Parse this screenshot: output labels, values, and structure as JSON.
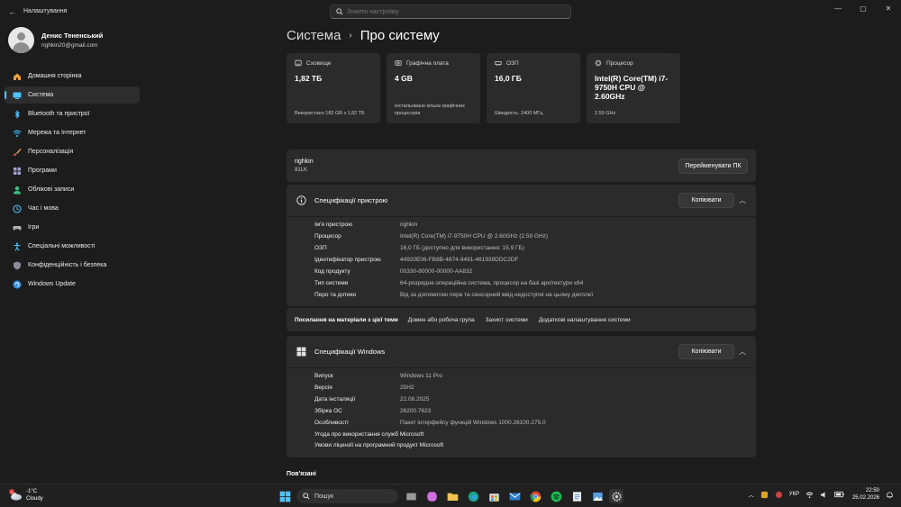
{
  "app": {
    "title": "Налаштування"
  },
  "search": {
    "placeholder": "Знайти настройку"
  },
  "profile": {
    "name": "Денис Тененський",
    "email": "righkin20@gmail.com"
  },
  "sidebar": {
    "items": [
      {
        "label": "Домашня сторінка",
        "icon": "home-icon"
      },
      {
        "label": "Система",
        "icon": "system-icon",
        "active": true
      },
      {
        "label": "Bluetooth та пристрої",
        "icon": "bluetooth-icon"
      },
      {
        "label": "Мережа та Інтернет",
        "icon": "network-icon"
      },
      {
        "label": "Персоналізація",
        "icon": "brush-icon"
      },
      {
        "label": "Програми",
        "icon": "apps-icon"
      },
      {
        "label": "Облікові записи",
        "icon": "account-icon"
      },
      {
        "label": "Час і мова",
        "icon": "clock-globe-icon"
      },
      {
        "label": "Ігри",
        "icon": "gamepad-icon"
      },
      {
        "label": "Спеціальні можливості",
        "icon": "accessibility-icon"
      },
      {
        "label": "Конфіденційність і безпека",
        "icon": "shield-icon"
      },
      {
        "label": "Windows Update",
        "icon": "update-icon"
      }
    ]
  },
  "breadcrumb": {
    "parent": "Система",
    "separator": "›",
    "current": "Про систему"
  },
  "cards": [
    {
      "title": "Сховище",
      "value": "1,82 ТБ",
      "sub": "Використано 182 GB з 1,82 ТБ",
      "icon": "storage-icon"
    },
    {
      "title": "Графічна плата",
      "value": "4 GB",
      "sub": "Інстальовано кілька графічних процесорів",
      "icon": "gpu-icon"
    },
    {
      "title": "ОЗП",
      "value": "16,0 ГБ",
      "sub": "Швидкість: 2400 МГц",
      "icon": "ram-icon"
    },
    {
      "title": "Процесор",
      "value": "Intel(R) Core(TM) i7-9750H CPU @ 2.60GHz",
      "sub": "2.59 GHz",
      "icon": "cpu-icon"
    }
  ],
  "pc": {
    "name": "righkin",
    "model": "81LK",
    "rename_label": "Перейменувати ПК"
  },
  "device_specs": {
    "title": "Специфікації пристрою",
    "copy_label": "Копіювати",
    "rows": [
      {
        "label": "Ім'я пристрою",
        "value": "righkin"
      },
      {
        "label": "Процесор",
        "value": "Intel(R) Core(TM) i7-9750H CPU @ 2.60GHz (2.59 GHz)"
      },
      {
        "label": "ОЗП",
        "value": "16,0 ГБ (доступно для використання: 15,9 ГБ)"
      },
      {
        "label": "Ідентифікатор пристрою",
        "value": "44920E06-FB8B-4874-9491-461939DDC2DF"
      },
      {
        "label": "Код продукту",
        "value": "00330-80000-00000-AA832"
      },
      {
        "label": "Тип системи",
        "value": "64-розрядна операційна система, процесор на базі архітектури x64"
      },
      {
        "label": "Перо та дотики",
        "value": "Від за допомогою пера та сенсорний ввід недоступні на цьому дисплеї"
      }
    ]
  },
  "related_links": {
    "label": "Посилання на матеріали з цієї теми",
    "links": [
      "Домен або робоча група",
      "Захист системи",
      "Додаткові налаштування системи"
    ]
  },
  "windows_specs": {
    "title": "Специфікації Windows",
    "copy_label": "Копіювати",
    "rows": [
      {
        "label": "Випуск",
        "value": "Windows 11 Pro"
      },
      {
        "label": "Версія",
        "value": "25H2"
      },
      {
        "label": "Дата інсталяції",
        "value": "22.08.2025"
      },
      {
        "label": "Збірка ОС",
        "value": "26200.7623"
      },
      {
        "label": "Особливості",
        "value": "Пакет інтерфейсу функцій Windows 1000.26100.275.0"
      }
    ],
    "links": [
      "Угода про використання служб Microsoft",
      "Умови ліцензії на програмний продукт Microsoft"
    ]
  },
  "related_title": "Пов'язані",
  "taskbar": {
    "weather_temp": "-1°C",
    "weather_desc": "Cloudy",
    "weather_badge": "1",
    "search_label": "Пошук",
    "language": "УКР",
    "time": "22:50",
    "date": "25.02.2026"
  }
}
